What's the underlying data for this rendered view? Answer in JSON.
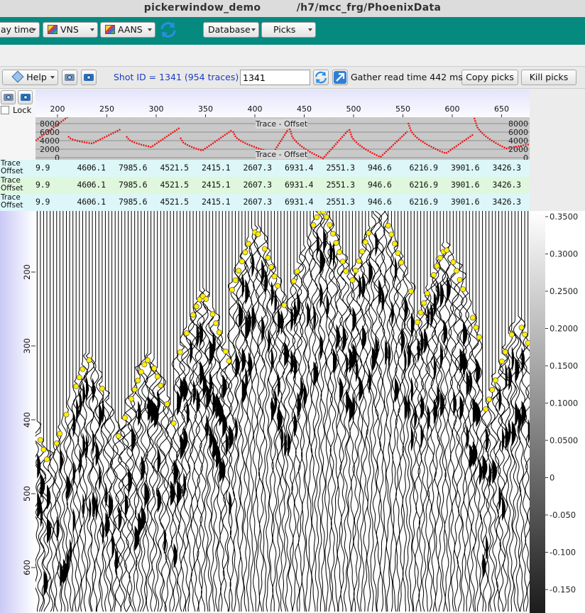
{
  "window": {
    "title_app": "pickerwindow_demo",
    "title_path": "/h7/mcc_frg/PhoenixData"
  },
  "toolbar": {
    "items": [
      {
        "label": "ay time",
        "dropdown": true
      },
      {
        "label": "VNS",
        "dropdown": true,
        "icon": "cube-icon"
      },
      {
        "label": "AANS",
        "dropdown": true,
        "icon": "cube-icon"
      },
      {
        "label": "Database",
        "dropdown": true
      },
      {
        "label": "Picks",
        "dropdown": true
      }
    ],
    "refresh_icon": "refresh-icon"
  },
  "toolbar2": {
    "help_label": "Help",
    "shot_label": "Shot ID = 1341 (954 traces)",
    "shot_value": "1341",
    "gather_time": "Gather read time 442 ms",
    "copy_picks": "Copy picks",
    "kill_picks": "Kill picks"
  },
  "side": {
    "lock_label": "Lock"
  },
  "trace_axis": {
    "ticks": [
      "200",
      "250",
      "300",
      "350",
      "400",
      "450",
      "500",
      "550",
      "600",
      "650"
    ]
  },
  "offset_plot": {
    "title": "Trace - Offset",
    "ticks": [
      "8000",
      "6000",
      "4000",
      "2000",
      "0"
    ]
  },
  "trace_rows": [
    {
      "label1": "Trace",
      "label2": "Offset",
      "values": [
        "9.9",
        "4606.1",
        "7985.6",
        "4521.5",
        "2415.1",
        "2607.3",
        "6931.4",
        "2551.3",
        "946.6",
        "6216.9",
        "3901.6",
        "3426.3"
      ],
      "bg": "#ddf7f9"
    },
    {
      "label1": "Trace",
      "label2": "Offset",
      "values": [
        "9.9",
        "4606.1",
        "7985.6",
        "4521.5",
        "2415.1",
        "2607.3",
        "6931.4",
        "2551.3",
        "946.6",
        "6216.9",
        "3901.6",
        "3426.3"
      ],
      "bg": "#dff7dd"
    },
    {
      "label1": "Trace",
      "label2": "Offset",
      "values": [
        "9.9",
        "4606.1",
        "7985.6",
        "4521.5",
        "2415.1",
        "2607.3",
        "6931.4",
        "2551.3",
        "946.6",
        "6216.9",
        "3901.6",
        "3426.3"
      ],
      "bg": "#ddf7f9"
    }
  ],
  "time_axis": {
    "ticks": [
      "200",
      "300",
      "400",
      "500",
      "600"
    ]
  },
  "colorbar": {
    "ticks": [
      "0.3500",
      "0.3000",
      "0.2500",
      "0.2000",
      "0.1500",
      "0.1000",
      "0.0500",
      "0",
      "-0.050",
      "-0.100",
      "-0.150"
    ]
  },
  "colors": {
    "teal": "#068a80",
    "pick": "#ffee00",
    "offset_curve": "#ee1111",
    "shot_text": "#1a3cc0"
  }
}
